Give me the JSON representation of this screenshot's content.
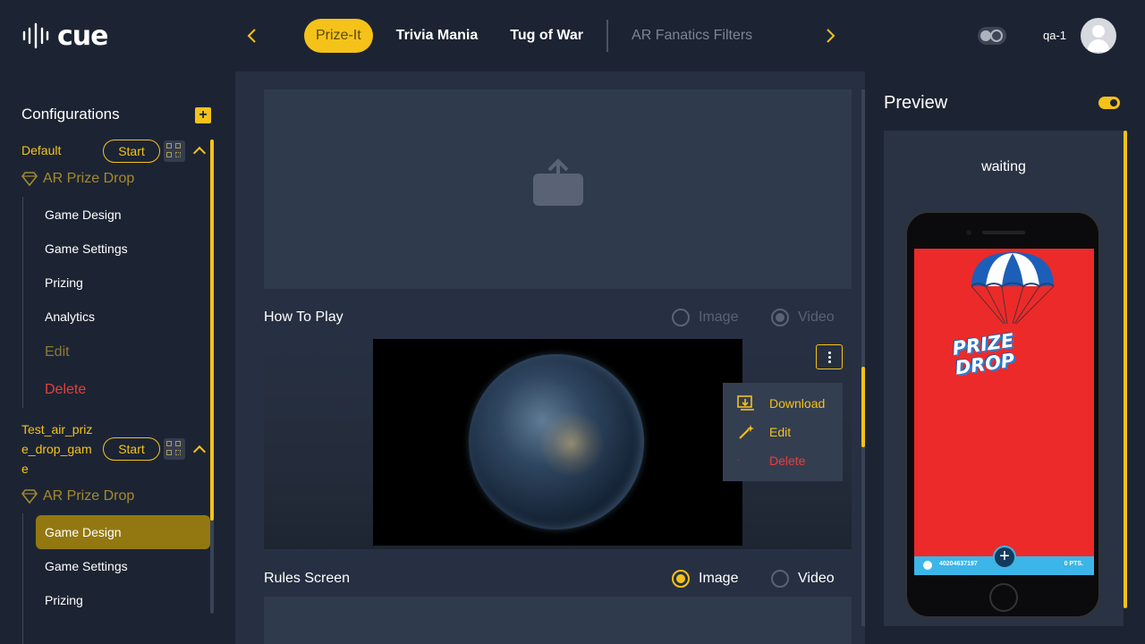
{
  "header": {
    "logo_text": "cue",
    "tabs": [
      {
        "label": "Prize-It",
        "state": "active"
      },
      {
        "label": "Trivia Mania",
        "state": "normal"
      },
      {
        "label": "Tug of War",
        "state": "normal"
      },
      {
        "label": "AR Fanatics Filters",
        "state": "dim"
      }
    ],
    "username": "qa-1"
  },
  "sidebar": {
    "title": "Configurations",
    "configs": [
      {
        "name": "Default",
        "start_label": "Start",
        "game_type": "AR Prize Drop",
        "items": [
          "Game Design",
          "Game Settings",
          "Prizing",
          "Analytics"
        ],
        "edit_label": "Edit",
        "delete_label": "Delete"
      },
      {
        "name_lines": [
          "Test_air_priz",
          "e_drop_gam",
          "e"
        ],
        "start_label": "Start",
        "game_type": "AR Prize Drop",
        "items": [
          "Game Design",
          "Game Settings",
          "Prizing"
        ],
        "selected": "Game Design"
      }
    ]
  },
  "main": {
    "how_to_play": {
      "label": "How To Play",
      "options": [
        "Image",
        "Video"
      ],
      "selected": "Video"
    },
    "context_menu": {
      "download": "Download",
      "edit": "Edit",
      "delete": "Delete"
    },
    "rules_screen": {
      "label": "Rules Screen",
      "options": [
        "Image",
        "Video"
      ],
      "selected": "Image"
    }
  },
  "preview": {
    "title": "Preview",
    "status": "waiting",
    "phone": {
      "logo_line1": "PRIZE",
      "logo_line2": "DROP",
      "player_id": "40204637197",
      "points": "0 PTS."
    }
  },
  "colors": {
    "accent": "#f5c21a",
    "background": "#1c2433",
    "panel": "#273042",
    "danger": "#e83e3e"
  }
}
